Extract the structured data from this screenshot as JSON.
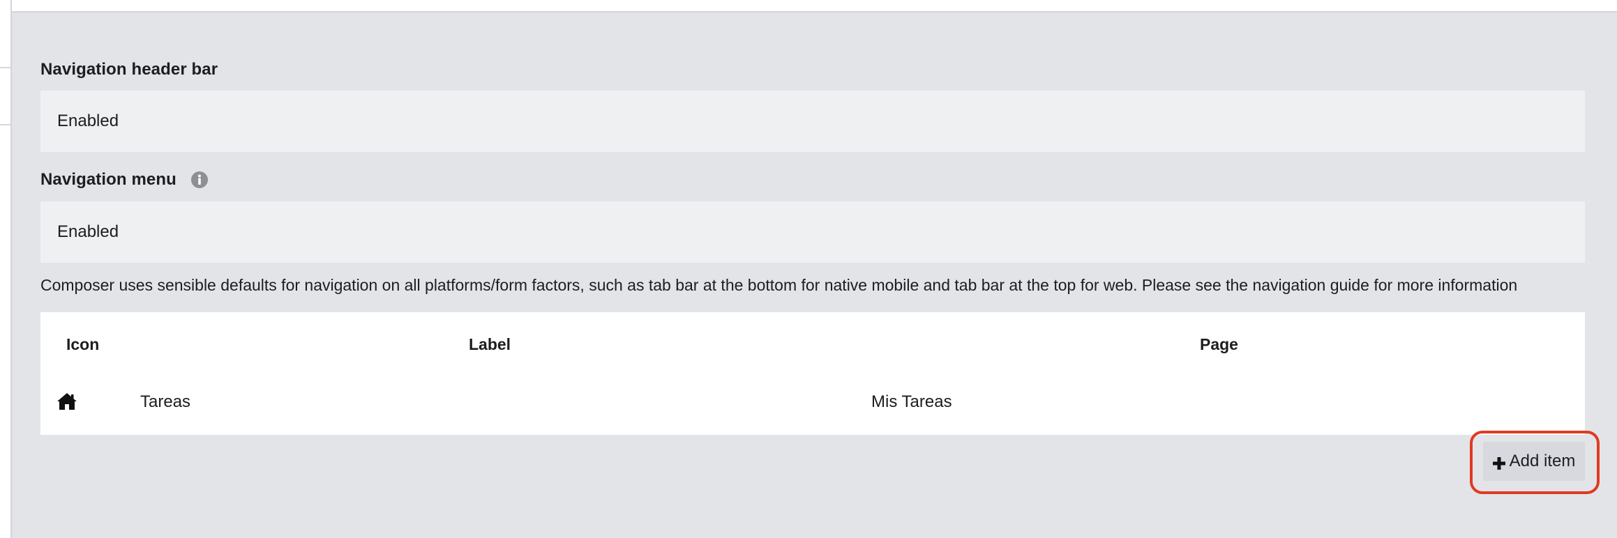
{
  "navigation_header_bar": {
    "label": "Navigation header bar",
    "value": "Enabled"
  },
  "navigation_menu": {
    "label": "Navigation menu",
    "info_icon": "info-icon",
    "value": "Enabled"
  },
  "help_text": "Composer uses sensible defaults for navigation on all platforms/form factors, such as tab bar at the bottom for native mobile and tab bar at the top for web. Please see the navigation guide for more information",
  "table": {
    "headers": [
      "Icon",
      "Label",
      "Page"
    ],
    "rows": [
      {
        "icon": "home-icon",
        "label": "Tareas",
        "page": "Mis Tareas"
      }
    ]
  },
  "add_item": {
    "label": "Add item",
    "icon": "plus-icon",
    "highlight_color": "#e03a22"
  }
}
